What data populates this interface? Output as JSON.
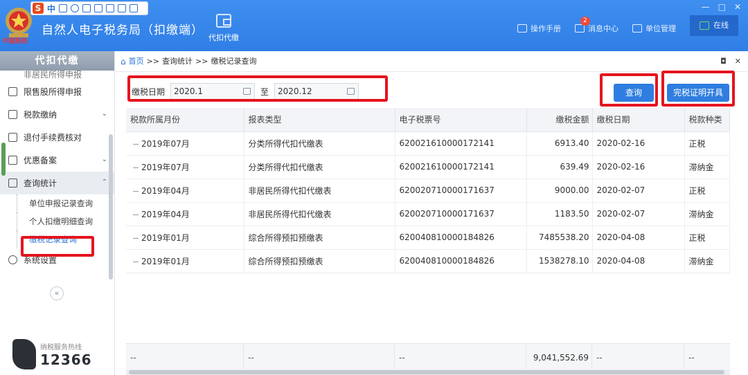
{
  "header": {
    "emblem_text": "中国税务",
    "ime": {
      "logo": "S",
      "mode": "中"
    },
    "app_title": "自然人电子税务局（扣缴端）",
    "nav": [
      {
        "label": "代扣代缴",
        "icon": "wallet-icon"
      }
    ],
    "right": [
      {
        "label": "操作手册",
        "icon": "manual-icon"
      },
      {
        "label": "消息中心",
        "icon": "message-icon",
        "badge": "2"
      },
      {
        "label": "单位管理",
        "icon": "building-icon"
      }
    ],
    "status": "在线",
    "window_controls": [
      "—",
      "□",
      "✕"
    ]
  },
  "sidebar": {
    "title": "代扣代缴",
    "partial_item": "非居民所得申报",
    "items": [
      {
        "label": "限售股所得申报",
        "icon": "chart-icon"
      },
      {
        "label": "税款缴纳",
        "icon": "folder-icon",
        "chevron": "⌄"
      },
      {
        "label": "退付手续费核对",
        "icon": "list-icon"
      },
      {
        "label": "优惠备案",
        "icon": "document-icon",
        "chevron": "⌄"
      },
      {
        "label": "查询统计",
        "icon": "query-icon",
        "chevron": "⌃"
      }
    ],
    "sub_items": [
      "单位申报记录查询",
      "个人扣缴明细查询",
      "缴税记录查询"
    ],
    "settings": "系统设置",
    "collapse": "«",
    "hotline_label": "纳税服务热线",
    "hotline_number": "12366"
  },
  "breadcrumb": {
    "home": "首页",
    "sep": ">>",
    "level1": "查询统计",
    "level2": "缴税记录查询",
    "controls": [
      "◘",
      "✕"
    ]
  },
  "filter": {
    "label": "缴税日期",
    "start": "2020.1",
    "to": "至",
    "end": "2020.12"
  },
  "buttons": {
    "query": "查询",
    "certificate": "完税证明开具"
  },
  "table": {
    "headers": [
      "税款所属月份",
      "报表类型",
      "电子税票号",
      "缴税金额",
      "缴税日期",
      "税款种类"
    ],
    "rows": [
      [
        "2019年07月",
        "分类所得代扣代缴表",
        "620021610000172141",
        "6913.40",
        "2020-02-16",
        "正税"
      ],
      [
        "2019年07月",
        "分类所得代扣代缴表",
        "620021610000172141",
        "639.49",
        "2020-02-16",
        "滞纳金"
      ],
      [
        "2019年04月",
        "非居民所得代扣代缴表",
        "620020710000171637",
        "9000.00",
        "2020-02-07",
        "正税"
      ],
      [
        "2019年04月",
        "非居民所得代扣代缴表",
        "620020710000171637",
        "1183.50",
        "2020-02-07",
        "滞纳金"
      ],
      [
        "2019年01月",
        "综合所得预扣预缴表",
        "620040810000184826",
        "7485538.20",
        "2020-04-08",
        "正税"
      ],
      [
        "2019年01月",
        "综合所得预扣预缴表",
        "620040810000184826",
        "1538278.10",
        "2020-04-08",
        "滞纳金"
      ]
    ],
    "footer": [
      "--",
      "--",
      "--",
      "9,041,552.69",
      "--",
      "--"
    ]
  },
  "colors": {
    "header_blue": "#2f7ee6",
    "accent_red": "#e4141e",
    "button_blue": "#2f7de0"
  }
}
